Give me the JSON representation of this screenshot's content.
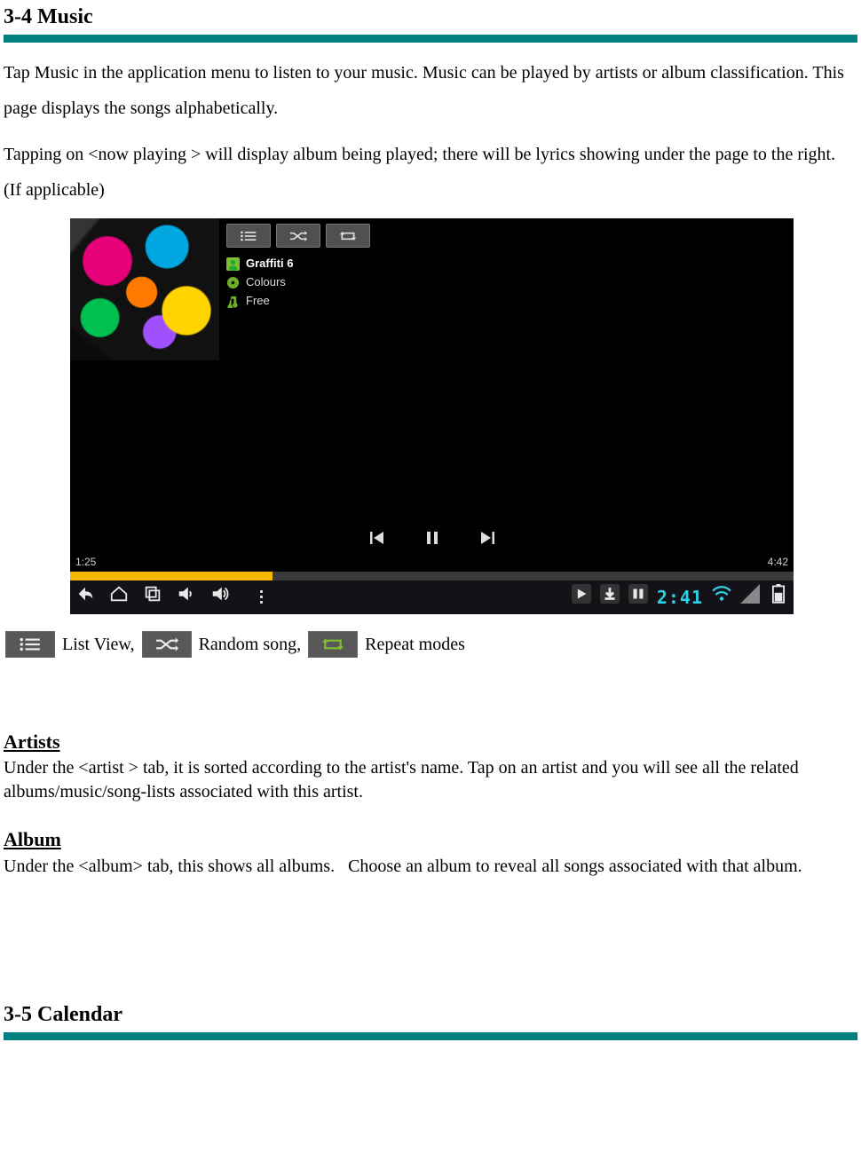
{
  "heading1": "3-4 Music",
  "para1": "Tap Music in the application menu to listen to your music. Music can be played by artists or album classification. This page displays the songs alphabetically.",
  "para2": "Tapping on <now playing > will display album being played; there will be lyrics showing under the page to the right. (If applicable)",
  "screenshot": {
    "artist": "Graffiti 6",
    "album": "Colours",
    "track": "Free",
    "elapsed": "1:25",
    "total": "4:42",
    "clock": "2:41"
  },
  "legend": {
    "list": "List View,",
    "random": "Random song,",
    "repeat": "Repeat modes"
  },
  "artists": {
    "title": "Artists",
    "text": "Under the <artist > tab, it is sorted according to the artist's name. Tap on an artist and you will see all the related albums/music/song-lists associated with this artist."
  },
  "album": {
    "title": "Album",
    "text": "Under the <album> tab, this shows all albums.   Choose an album to reveal all songs associated with that album."
  },
  "heading2": "3-5 Calendar"
}
